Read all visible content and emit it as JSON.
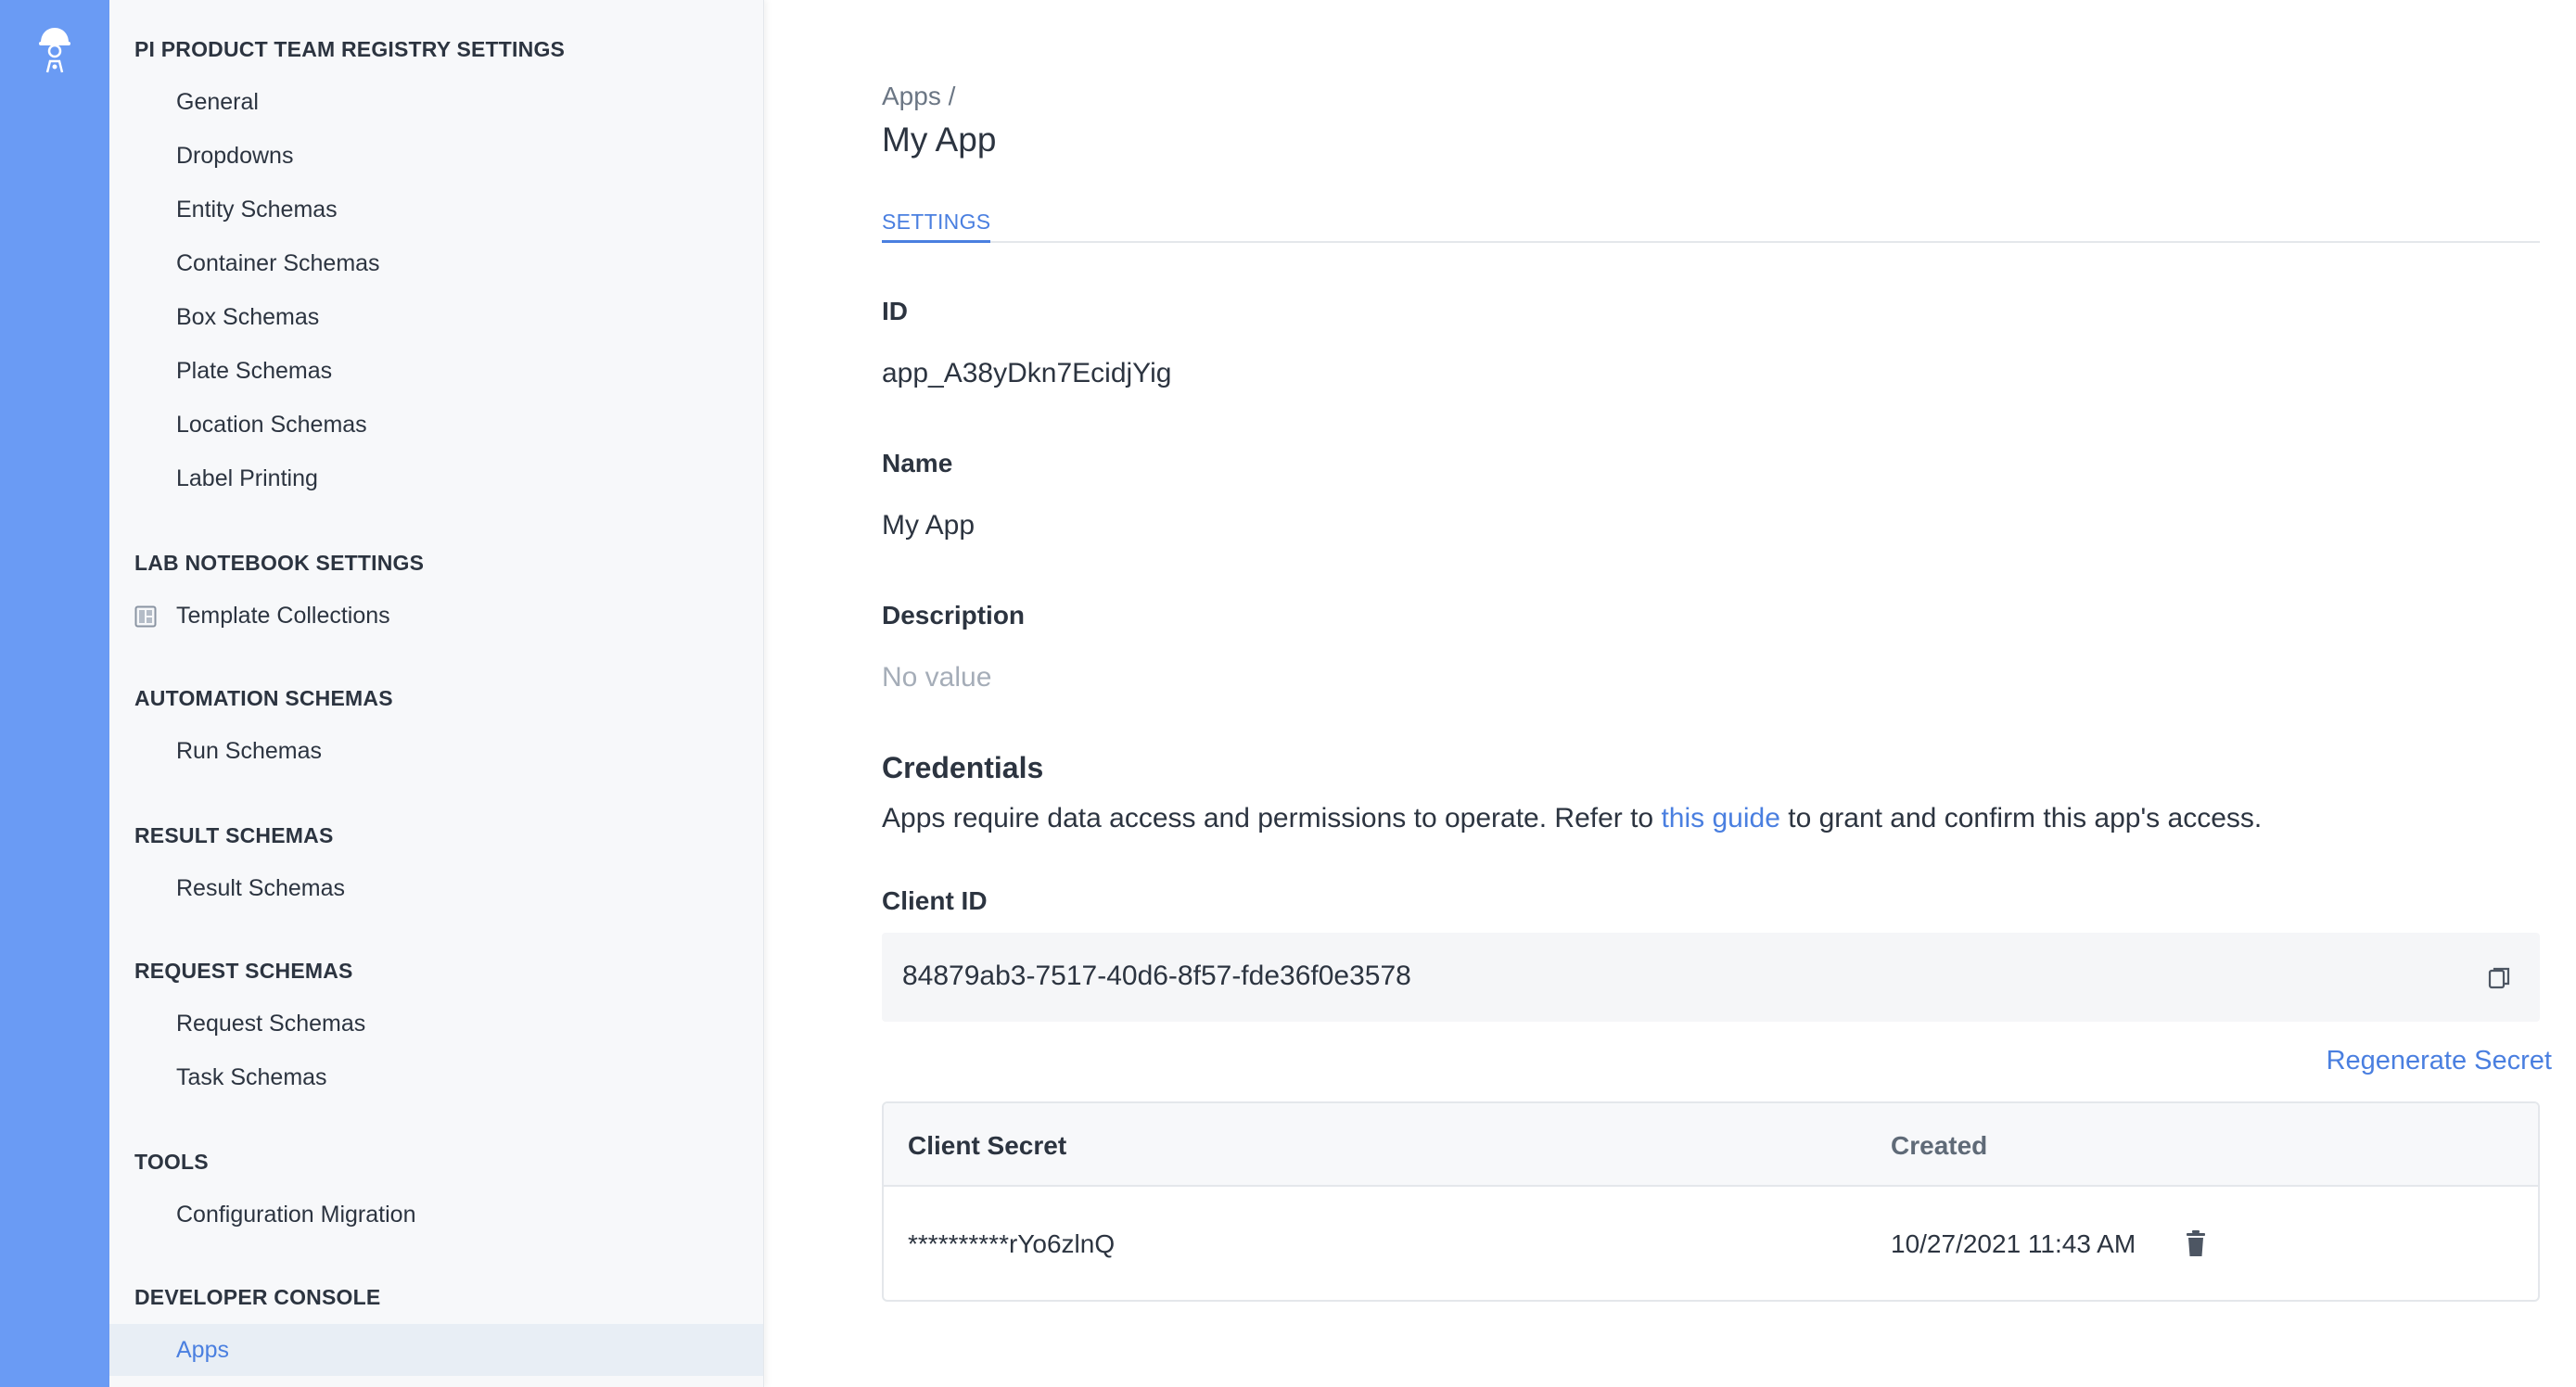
{
  "nav": {
    "sections": [
      {
        "heading": "PI PRODUCT TEAM REGISTRY SETTINGS",
        "items": [
          "General",
          "Dropdowns",
          "Entity Schemas",
          "Container Schemas",
          "Box Schemas",
          "Plate Schemas",
          "Location Schemas",
          "Label Printing"
        ]
      },
      {
        "heading": "LAB NOTEBOOK SETTINGS",
        "items": [
          "Template Collections"
        ]
      },
      {
        "heading": "AUTOMATION SCHEMAS",
        "items": [
          "Run Schemas"
        ]
      },
      {
        "heading": "RESULT SCHEMAS",
        "items": [
          "Result Schemas"
        ]
      },
      {
        "heading": "REQUEST SCHEMAS",
        "items": [
          "Request Schemas",
          "Task Schemas"
        ]
      },
      {
        "heading": "TOOLS",
        "items": [
          "Configuration Migration"
        ]
      },
      {
        "heading": "DEVELOPER CONSOLE",
        "items": [
          "Apps"
        ]
      }
    ],
    "active_item": "Apps"
  },
  "header": {
    "breadcrumb": "Apps /",
    "title": "My App"
  },
  "tabs": [
    "SETTINGS"
  ],
  "fields": {
    "id_label": "ID",
    "id_value": "app_A38yDkn7EcidjYig",
    "name_label": "Name",
    "name_value": "My App",
    "description_label": "Description",
    "description_value": "No value"
  },
  "credentials": {
    "title": "Credentials",
    "desc_before": "Apps require data access and permissions to operate. Refer to ",
    "desc_link": "this guide",
    "desc_after": " to grant and confirm this app's access.",
    "client_id_label": "Client ID",
    "client_id_value": "84879ab3-7517-40d6-8f57-fde36f0e3578",
    "regenerate_label": "Regenerate Secret",
    "table": {
      "col_secret": "Client Secret",
      "col_created": "Created",
      "rows": [
        {
          "secret": "**********rYo6zlnQ",
          "created": "10/27/2021 11:43 AM"
        }
      ]
    }
  },
  "colors": {
    "rail": "#6a9bf4",
    "accent": "#4a7fe0",
    "nav_bg": "#f7f8fa",
    "active_bg": "#e8eef5"
  },
  "icons": {
    "logo": "scientist-logo-icon",
    "template_collections": "template-grid-icon",
    "copy": "copy-icon",
    "delete": "trash-icon"
  }
}
